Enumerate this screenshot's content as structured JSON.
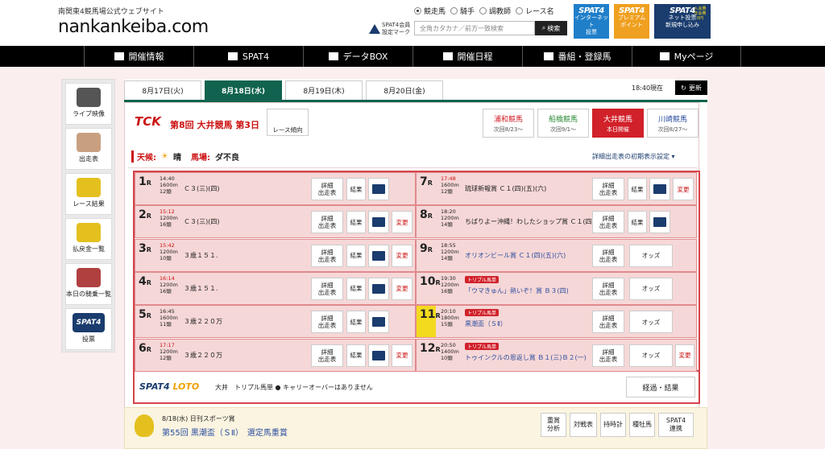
{
  "header": {
    "tagline": "南関東4競馬場公式ウェブサイト",
    "logo": "nankankeiba.com",
    "spat_mark": "SPAT4会員\n設定マーク",
    "radios": [
      {
        "label": "競走馬",
        "selected": true
      },
      {
        "label": "騎手",
        "selected": false
      },
      {
        "label": "調教師",
        "selected": false
      },
      {
        "label": "レース名",
        "selected": false
      }
    ],
    "search_placeholder": "全角カタカナ／前方一致検索",
    "search_button": "検索",
    "banners": [
      {
        "title": "SPAT4",
        "sub": "インターネット\n投票",
        "color": "#1f7fc9"
      },
      {
        "title": "SPAT4",
        "sub": "プレミアム\nポイント",
        "color": "#f0a020"
      },
      {
        "title": "SPAT4",
        "sub": "ネット投票\n新規申し込み",
        "color": "#1a3c6e",
        "badge": "入会費\n年会費\n0円"
      }
    ]
  },
  "nav": [
    {
      "label": "開催情報",
      "icon": "calendar-grid-icon"
    },
    {
      "label": "SPAT4",
      "icon": "mountain-icon"
    },
    {
      "label": "データBOX",
      "icon": "data-box-icon"
    },
    {
      "label": "開催日程",
      "icon": "schedule-icon"
    },
    {
      "label": "番組・登録馬",
      "icon": "program-icon"
    },
    {
      "label": "Myページ",
      "icon": "user-icon"
    }
  ],
  "sidebar": [
    {
      "label": "ライブ映像",
      "icon": "camera-icon"
    },
    {
      "label": "出走表",
      "icon": "entry-table-icon"
    },
    {
      "label": "レース結果",
      "icon": "result-icon"
    },
    {
      "label": "払戻金一覧",
      "icon": "coins-icon"
    },
    {
      "label": "本日の騎乗一覧",
      "icon": "jockey-icon"
    },
    {
      "label": "投票",
      "icon": "spat4-logo-icon",
      "logo": "SPAT4"
    }
  ],
  "date_tabs": [
    {
      "label": "8月17日(火)",
      "active": false
    },
    {
      "label": "8月18日(水)",
      "active": true
    },
    {
      "label": "8月19日(木)",
      "active": false
    },
    {
      "label": "8月20日(金)",
      "active": false
    }
  ],
  "now_time": "18:40現在",
  "refresh": "更新",
  "meeting": {
    "logo": "TCK",
    "title": "第8回 大井競馬 第3日",
    "trend": "レース傾向"
  },
  "venues": [
    {
      "name": "浦和競馬",
      "sub": "次回8/23～",
      "color": "#d1212a",
      "active": false
    },
    {
      "name": "船橋競馬",
      "sub": "次回9/1～",
      "color": "#2e8b3a",
      "active": false
    },
    {
      "name": "大井競馬",
      "sub": "本日開催",
      "color": "#ffffff",
      "active": true
    },
    {
      "name": "川崎競馬",
      "sub": "次回8/27～",
      "color": "#2b4ea0",
      "active": false
    }
  ],
  "weather": {
    "weather_label": "天候:",
    "weather_value": "晴",
    "track_label": "馬場:",
    "track_value": "ダ不良"
  },
  "detail_setting": "詳細出走表の初期表示設定",
  "races": [
    {
      "no": "1",
      "time": "14:40",
      "dist": "1600m",
      "heads": "12頭",
      "name": "Ｃ３(三)(四)",
      "time_red": false,
      "buttons": [
        "詳細\n出走表",
        "結果",
        "tv"
      ],
      "triple": false
    },
    {
      "no": "2",
      "time": "15:12",
      "dist": "1200m",
      "heads": "16頭",
      "name": "Ｃ３(三)(四)",
      "time_red": true,
      "buttons": [
        "詳細\n出走表",
        "結果",
        "tv",
        "変更"
      ],
      "triple": false
    },
    {
      "no": "3",
      "time": "15:42",
      "dist": "1200m",
      "heads": "10頭",
      "name": "３歳１５１.",
      "time_red": true,
      "buttons": [
        "詳細\n出走表",
        "結果",
        "tv",
        "変更"
      ],
      "triple": false
    },
    {
      "no": "4",
      "time": "16:14",
      "dist": "1200m",
      "heads": "16頭",
      "name": "３歳１５１.",
      "time_red": true,
      "buttons": [
        "詳細\n出走表",
        "結果",
        "tv",
        "変更"
      ],
      "triple": false
    },
    {
      "no": "5",
      "time": "16:45",
      "dist": "1600m",
      "heads": "11頭",
      "name": "３歳２２０万",
      "time_red": false,
      "buttons": [
        "詳細\n出走表",
        "結果",
        "tv"
      ],
      "triple": false
    },
    {
      "no": "6",
      "time": "17:17",
      "dist": "1200m",
      "heads": "12頭",
      "name": "３歳２２０万",
      "time_red": true,
      "buttons": [
        "詳細\n出走表",
        "結果",
        "tv",
        "変更"
      ],
      "triple": false
    },
    {
      "no": "7",
      "time": "17:48",
      "dist": "1600m",
      "heads": "12頭",
      "name": "琉球新報賞 Ｃ１(四)(五)(六)",
      "time_red": true,
      "buttons": [
        "詳細\n出走表",
        "結果",
        "tv",
        "変更"
      ],
      "triple": false
    },
    {
      "no": "8",
      "time": "18:20",
      "dist": "1200m",
      "heads": "14頭",
      "name": "ちばりよー沖縄！わしたショップ賞 Ｃ１(四)(五)(六)",
      "time_red": false,
      "buttons": [
        "詳細\n出走表",
        "結果",
        "tv"
      ],
      "triple": false
    },
    {
      "no": "9",
      "time": "18:55",
      "dist": "1200m",
      "heads": "14頭",
      "name": "オリオンビール賞 Ｃ１(四)(五)(六)",
      "time_red": false,
      "buttons": [
        "詳細\n出走表",
        "オッズ"
      ],
      "triple": false,
      "blue": true
    },
    {
      "no": "10",
      "time": "19:30",
      "dist": "1200m",
      "heads": "16頭",
      "name": "「ウマきゅん」熱いぞ！賞 Ｂ３(四)",
      "time_red": false,
      "buttons": [
        "詳細\n出走表",
        "オッズ"
      ],
      "triple": true,
      "blue": true
    },
    {
      "no": "11",
      "time": "20:10",
      "dist": "1800m",
      "heads": "15頭",
      "name": "黒潮盃（ＳⅡ）",
      "time_red": false,
      "buttons": [
        "詳細\n出走表",
        "オッズ"
      ],
      "triple": true,
      "blue": true,
      "main": true
    },
    {
      "no": "12",
      "time": "20:50",
      "dist": "1400m",
      "heads": "10頭",
      "name": "トゥインクルの恩返し賞 Ｂ１(三)Ｂ２(一)",
      "time_red": false,
      "buttons": [
        "詳細\n出走表",
        "オッズ",
        "変更"
      ],
      "triple": true,
      "blue": true
    }
  ],
  "race_suffix": "R",
  "triple_label": "トリプル馬単",
  "loto": {
    "logo1": "SPAT4",
    "logo2": "LOTO",
    "text": "大井　トリプル馬単 ● キャリーオーバーはありません",
    "button": "経過・結果"
  },
  "feature": {
    "date": "8/18(水) 日刊スポーツ賞",
    "title": "第55回 黒潮盃（ＳⅡ）　選定馬重賞",
    "buttons": [
      "重賞\n分析",
      "対戦表",
      "持時計",
      "種牡馬",
      "SPAT4\n連携"
    ]
  },
  "colors": {
    "brand_green": "#11634f",
    "accent_red": "#d1212a",
    "navy": "#1a3c6e",
    "panel_pink": "#f6d7d7"
  }
}
